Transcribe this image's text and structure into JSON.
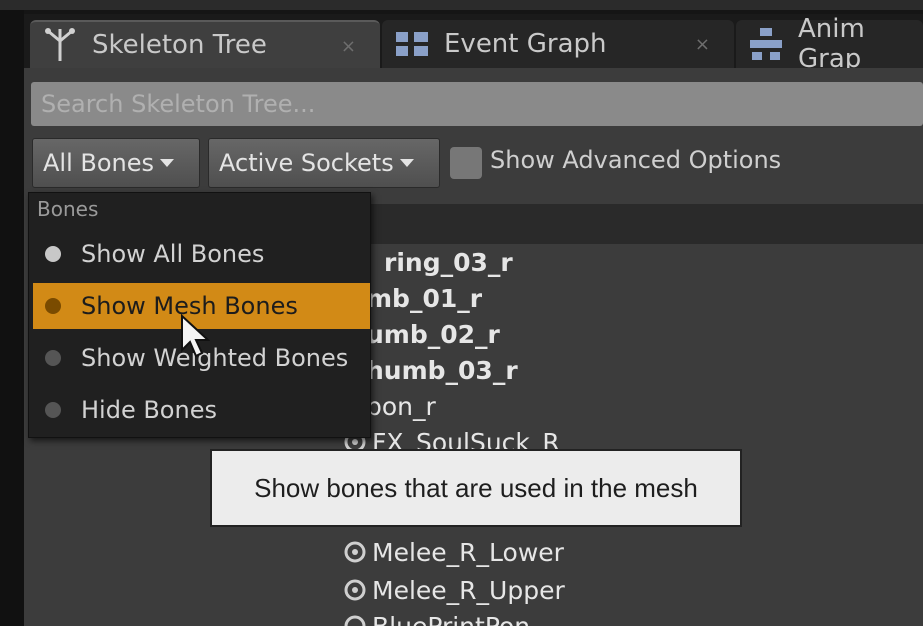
{
  "tabs": [
    {
      "label": "Skeleton Tree",
      "icon": "skeleton-tree-icon",
      "close": "×"
    },
    {
      "label": "Event Graph",
      "icon": "event-graph-icon",
      "close": "×"
    },
    {
      "label": "Anim Grap",
      "icon": "anim-graph-icon"
    }
  ],
  "search": {
    "placeholder": "Search Skeleton Tree..."
  },
  "toolbar": {
    "bones_combo": "All Bones",
    "sockets_combo": "Active Sockets",
    "advanced_label": "Show Advanced Options",
    "advanced_checked": false
  },
  "bones_menu": {
    "heading": "Bones",
    "items": [
      {
        "label": "Show All Bones",
        "dot_color": "#c8c8c8"
      },
      {
        "label": "Show Mesh Bones",
        "dot_color": "#7a4b00",
        "selected": true
      },
      {
        "label": "Show Weighted Bones",
        "dot_color": "#555555"
      },
      {
        "label": "Hide Bones",
        "dot_color": "#555555"
      }
    ]
  },
  "tree_rows": [
    "ring_03_r",
    "mb_01_r",
    "umb_02_r",
    "humb_03_r",
    "pon_r",
    "FX_SoulSuck_R",
    "Melee_R_Lower",
    "Melee_R_Upper",
    "BluePrintPon"
  ],
  "tooltip": "Show bones that are used in the mesh",
  "colors": {
    "accent": "#d28a16",
    "panel": "#3c3c3c",
    "tooltip_bg": "#ececec"
  }
}
